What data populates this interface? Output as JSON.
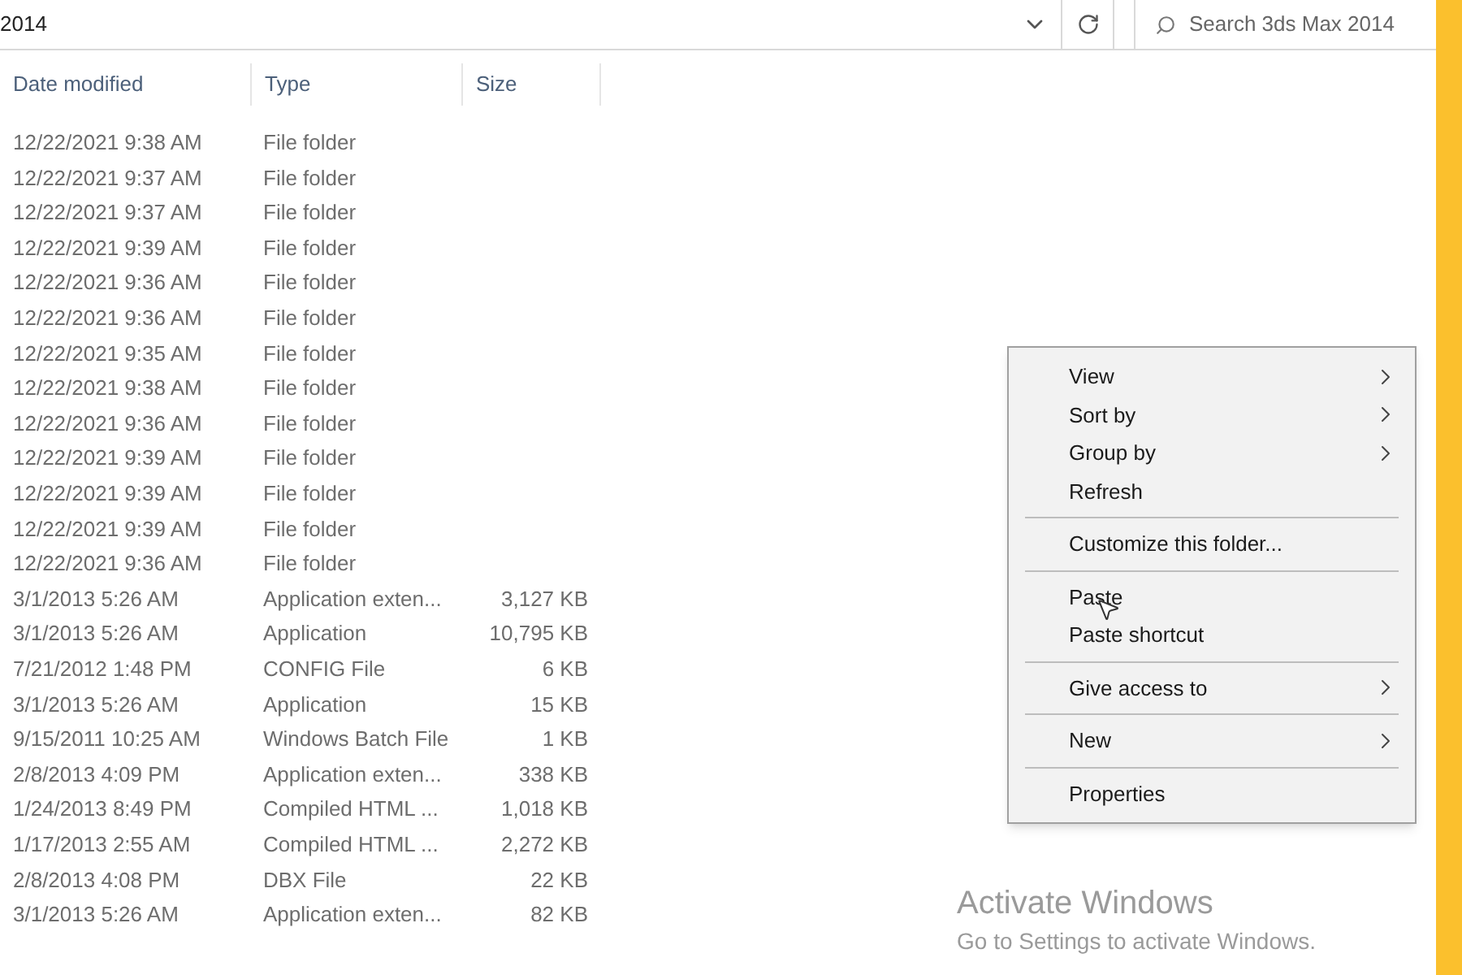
{
  "address_bar": {
    "path": "2014"
  },
  "search": {
    "placeholder": "Search 3ds Max 2014"
  },
  "table": {
    "columns": [
      "Date modified",
      "Type",
      "Size"
    ],
    "rows": [
      {
        "date": "12/22/2021 9:38 AM",
        "type": "File folder",
        "size": ""
      },
      {
        "date": "12/22/2021 9:37 AM",
        "type": "File folder",
        "size": ""
      },
      {
        "date": "12/22/2021 9:37 AM",
        "type": "File folder",
        "size": ""
      },
      {
        "date": "12/22/2021 9:39 AM",
        "type": "File folder",
        "size": ""
      },
      {
        "date": "12/22/2021 9:36 AM",
        "type": "File folder",
        "size": ""
      },
      {
        "date": "12/22/2021 9:36 AM",
        "type": "File folder",
        "size": ""
      },
      {
        "date": "12/22/2021 9:35 AM",
        "type": "File folder",
        "size": ""
      },
      {
        "date": "12/22/2021 9:38 AM",
        "type": "File folder",
        "size": ""
      },
      {
        "date": "12/22/2021 9:36 AM",
        "type": "File folder",
        "size": ""
      },
      {
        "date": "12/22/2021 9:39 AM",
        "type": "File folder",
        "size": ""
      },
      {
        "date": "12/22/2021 9:39 AM",
        "type": "File folder",
        "size": ""
      },
      {
        "date": "12/22/2021 9:39 AM",
        "type": "File folder",
        "size": ""
      },
      {
        "date": "12/22/2021 9:36 AM",
        "type": "File folder",
        "size": ""
      },
      {
        "date": "3/1/2013 5:26 AM",
        "type": "Application exten...",
        "size": "3,127 KB"
      },
      {
        "date": "3/1/2013 5:26 AM",
        "type": "Application",
        "size": "10,795 KB"
      },
      {
        "date": "7/21/2012 1:48 PM",
        "type": "CONFIG File",
        "size": "6 KB"
      },
      {
        "date": "3/1/2013 5:26 AM",
        "type": "Application",
        "size": "15 KB"
      },
      {
        "date": "9/15/2011 10:25 AM",
        "type": "Windows Batch File",
        "size": "1 KB"
      },
      {
        "date": "2/8/2013 4:09 PM",
        "type": "Application exten...",
        "size": "338 KB"
      },
      {
        "date": "1/24/2013 8:49 PM",
        "type": "Compiled HTML ...",
        "size": "1,018 KB"
      },
      {
        "date": "1/17/2013 2:55 AM",
        "type": "Compiled HTML ...",
        "size": "2,272 KB"
      },
      {
        "date": "2/8/2013 4:08 PM",
        "type": "DBX File",
        "size": "22 KB"
      },
      {
        "date": "3/1/2013 5:26 AM",
        "type": "Application exten...",
        "size": "82 KB"
      }
    ]
  },
  "context_menu": {
    "groups": [
      [
        {
          "label": "View",
          "submenu": true
        },
        {
          "label": "Sort by",
          "submenu": true
        },
        {
          "label": "Group by",
          "submenu": true
        },
        {
          "label": "Refresh",
          "submenu": false
        }
      ],
      [
        {
          "label": "Customize this folder...",
          "submenu": false
        }
      ],
      [
        {
          "label": "Paste",
          "submenu": false
        },
        {
          "label": "Paste shortcut",
          "submenu": false
        }
      ],
      [
        {
          "label": "Give access to",
          "submenu": true
        }
      ],
      [
        {
          "label": "New",
          "submenu": true
        }
      ],
      [
        {
          "label": "Properties",
          "submenu": false
        }
      ]
    ]
  },
  "activation_notice": {
    "title": "Activate Windows",
    "message": "Go to Settings to activate Windows."
  }
}
